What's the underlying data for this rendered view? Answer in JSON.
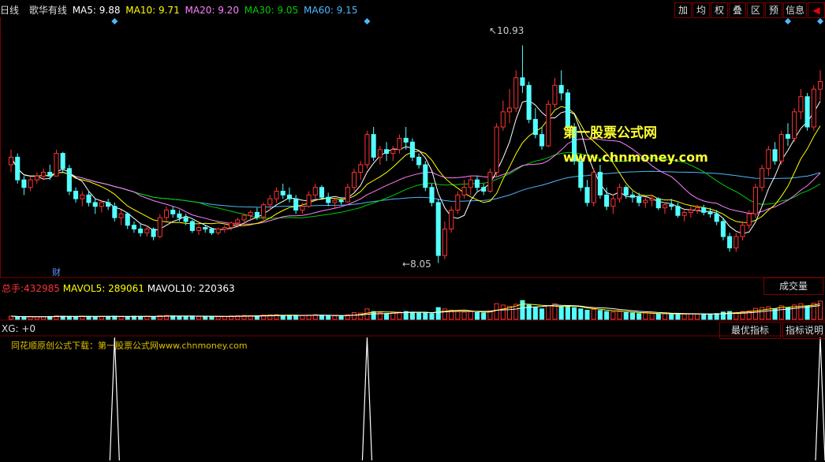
{
  "legend": {
    "period": "日线",
    "name": "歌华有线",
    "ma5": "MA5: 9.88",
    "ma10": "MA10: 9.71",
    "ma20": "MA20: 9.20",
    "ma30": "MA30: 9.05",
    "ma60": "MA60: 9.15"
  },
  "toolbar": [
    "加",
    "均",
    "权",
    "叠",
    "区",
    "预",
    "信息",
    "◀"
  ],
  "price_labels": {
    "high": "10.93",
    "low": "8.05"
  },
  "marker_cai": "财",
  "watermark": {
    "line1": "第一股票公式网",
    "line2": "www.chnmoney.com"
  },
  "volume": {
    "total_label": "总手:",
    "total_value": "432985",
    "mavol5": "MAVOL5: 289061",
    "mavol10": "MAVOL10: 220363",
    "tab": "成交量"
  },
  "xg": {
    "label": "XG: +0",
    "btn_best": "最优指标",
    "btn_desc": "指标说明",
    "note": "同花顺原创公式下载：第一股票公式网www.chnmoney.com"
  },
  "colors": {
    "up": "#ff3333",
    "down": "#54ffff",
    "ma5": "#ffffff",
    "ma10": "#ffff00",
    "ma20": "#ff80ff",
    "ma30": "#00cc00",
    "ma60": "#4db8ff",
    "border": "#7a0000"
  },
  "chart_data": {
    "type": "candlestick",
    "price_range": [
      7.9,
      11.3
    ],
    "candles": [
      [
        9.35,
        9.55,
        9.25,
        9.45
      ],
      [
        9.45,
        9.5,
        9.1,
        9.15
      ],
      [
        9.15,
        9.2,
        8.95,
        9.05
      ],
      [
        9.05,
        9.2,
        9.0,
        9.15
      ],
      [
        9.15,
        9.25,
        9.1,
        9.2
      ],
      [
        9.2,
        9.3,
        9.15,
        9.25
      ],
      [
        9.25,
        9.35,
        9.15,
        9.2
      ],
      [
        9.2,
        9.55,
        9.2,
        9.5
      ],
      [
        9.5,
        9.52,
        9.25,
        9.3
      ],
      [
        9.3,
        9.35,
        8.95,
        9.0
      ],
      [
        9.0,
        9.05,
        8.85,
        8.9
      ],
      [
        8.9,
        9.0,
        8.8,
        8.95
      ],
      [
        8.95,
        9.0,
        8.8,
        8.85
      ],
      [
        8.85,
        8.9,
        8.7,
        8.8
      ],
      [
        8.8,
        8.88,
        8.72,
        8.85
      ],
      [
        8.85,
        8.9,
        8.75,
        8.8
      ],
      [
        8.8,
        8.85,
        8.6,
        8.65
      ],
      [
        8.65,
        8.75,
        8.55,
        8.7
      ],
      [
        8.7,
        8.72,
        8.5,
        8.55
      ],
      [
        8.55,
        8.6,
        8.45,
        8.5
      ],
      [
        8.5,
        8.58,
        8.4,
        8.45
      ],
      [
        8.45,
        8.55,
        8.4,
        8.5
      ],
      [
        8.5,
        8.52,
        8.35,
        8.4
      ],
      [
        8.4,
        8.7,
        8.38,
        8.65
      ],
      [
        8.65,
        8.8,
        8.6,
        8.75
      ],
      [
        8.75,
        8.8,
        8.65,
        8.7
      ],
      [
        8.7,
        8.75,
        8.6,
        8.65
      ],
      [
        8.65,
        8.7,
        8.55,
        8.6
      ],
      [
        8.6,
        8.62,
        8.45,
        8.48
      ],
      [
        8.48,
        8.55,
        8.42,
        8.52
      ],
      [
        8.52,
        8.55,
        8.45,
        8.5
      ],
      [
        8.5,
        8.52,
        8.42,
        8.45
      ],
      [
        8.45,
        8.52,
        8.42,
        8.5
      ],
      [
        8.5,
        8.55,
        8.45,
        8.52
      ],
      [
        8.52,
        8.6,
        8.48,
        8.58
      ],
      [
        8.58,
        8.65,
        8.52,
        8.62
      ],
      [
        8.62,
        8.7,
        8.55,
        8.68
      ],
      [
        8.68,
        8.75,
        8.6,
        8.72
      ],
      [
        8.72,
        8.78,
        8.62,
        8.66
      ],
      [
        8.66,
        8.85,
        8.62,
        8.82
      ],
      [
        8.82,
        8.95,
        8.75,
        8.9
      ],
      [
        8.9,
        9.05,
        8.85,
        9.0
      ],
      [
        9.0,
        9.1,
        8.9,
        8.95
      ],
      [
        8.95,
        9.05,
        8.85,
        8.9
      ],
      [
        8.9,
        8.95,
        8.7,
        8.75
      ],
      [
        8.75,
        8.85,
        8.7,
        8.8
      ],
      [
        8.8,
        9.0,
        8.78,
        8.95
      ],
      [
        8.95,
        9.1,
        8.9,
        9.05
      ],
      [
        9.05,
        9.08,
        8.9,
        8.92
      ],
      [
        8.92,
        8.98,
        8.8,
        8.85
      ],
      [
        8.85,
        8.9,
        8.78,
        8.88
      ],
      [
        8.88,
        8.92,
        8.82,
        8.86
      ],
      [
        8.86,
        9.1,
        8.85,
        9.05
      ],
      [
        9.05,
        9.3,
        9.0,
        9.25
      ],
      [
        9.25,
        9.4,
        9.15,
        9.35
      ],
      [
        9.35,
        9.8,
        9.3,
        9.75
      ],
      [
        9.75,
        9.85,
        9.4,
        9.45
      ],
      [
        9.45,
        9.6,
        9.35,
        9.55
      ],
      [
        9.55,
        9.65,
        9.4,
        9.5
      ],
      [
        9.5,
        9.6,
        9.4,
        9.55
      ],
      [
        9.55,
        9.75,
        9.5,
        9.7
      ],
      [
        9.7,
        9.85,
        9.55,
        9.65
      ],
      [
        9.65,
        9.7,
        9.4,
        9.45
      ],
      [
        9.45,
        9.5,
        9.3,
        9.35
      ],
      [
        9.35,
        9.4,
        9.0,
        9.05
      ],
      [
        9.05,
        9.1,
        8.8,
        8.85
      ],
      [
        8.85,
        8.9,
        8.05,
        8.15
      ],
      [
        8.15,
        8.6,
        8.1,
        8.5
      ],
      [
        8.5,
        8.8,
        8.45,
        8.75
      ],
      [
        8.75,
        9.0,
        8.7,
        8.95
      ],
      [
        8.95,
        9.15,
        8.9,
        9.05
      ],
      [
        9.05,
        9.2,
        8.95,
        9.15
      ],
      [
        9.15,
        9.2,
        9.0,
        9.05
      ],
      [
        9.05,
        9.1,
        8.95,
        9.0
      ],
      [
        9.0,
        9.3,
        8.98,
        9.25
      ],
      [
        9.25,
        9.9,
        9.2,
        9.85
      ],
      [
        9.85,
        10.2,
        9.8,
        10.05
      ],
      [
        10.05,
        10.35,
        9.9,
        10.1
      ],
      [
        10.1,
        10.6,
        10.05,
        10.5
      ],
      [
        10.5,
        10.93,
        10.3,
        10.4
      ],
      [
        10.4,
        10.45,
        9.9,
        9.95
      ],
      [
        9.95,
        10.1,
        9.7,
        9.75
      ],
      [
        9.75,
        9.85,
        9.55,
        9.6
      ],
      [
        9.6,
        10.2,
        9.58,
        10.15
      ],
      [
        10.15,
        10.5,
        10.1,
        10.4
      ],
      [
        10.4,
        10.6,
        10.2,
        10.3
      ],
      [
        10.3,
        10.35,
        9.8,
        9.85
      ],
      [
        9.85,
        9.9,
        9.35,
        9.4
      ],
      [
        9.4,
        9.5,
        9.0,
        9.05
      ],
      [
        9.05,
        9.15,
        8.8,
        8.85
      ],
      [
        8.85,
        9.3,
        8.8,
        9.25
      ],
      [
        9.25,
        9.35,
        8.9,
        8.95
      ],
      [
        8.95,
        9.05,
        8.75,
        8.8
      ],
      [
        8.8,
        8.95,
        8.7,
        8.9
      ],
      [
        8.9,
        9.1,
        8.85,
        9.05
      ],
      [
        9.05,
        9.08,
        8.9,
        8.95
      ],
      [
        8.95,
        9.0,
        8.85,
        8.92
      ],
      [
        8.92,
        8.98,
        8.8,
        8.85
      ],
      [
        8.85,
        8.92,
        8.78,
        8.88
      ],
      [
        8.88,
        8.95,
        8.8,
        8.9
      ],
      [
        8.9,
        8.92,
        8.75,
        8.78
      ],
      [
        8.78,
        8.85,
        8.7,
        8.82
      ],
      [
        8.82,
        8.9,
        8.75,
        8.8
      ],
      [
        8.8,
        8.85,
        8.65,
        8.68
      ],
      [
        8.68,
        8.75,
        8.6,
        8.72
      ],
      [
        8.72,
        8.8,
        8.65,
        8.75
      ],
      [
        8.75,
        8.82,
        8.7,
        8.78
      ],
      [
        8.78,
        8.82,
        8.68,
        8.72
      ],
      [
        8.72,
        8.78,
        8.65,
        8.7
      ],
      [
        8.7,
        8.75,
        8.55,
        8.6
      ],
      [
        8.6,
        8.65,
        8.35,
        8.4
      ],
      [
        8.4,
        8.45,
        8.2,
        8.25
      ],
      [
        8.25,
        8.45,
        8.2,
        8.4
      ],
      [
        8.4,
        8.6,
        8.35,
        8.55
      ],
      [
        8.55,
        8.75,
        8.5,
        8.7
      ],
      [
        8.7,
        9.1,
        8.65,
        9.05
      ],
      [
        9.05,
        9.35,
        9.0,
        9.3
      ],
      [
        9.3,
        9.6,
        9.2,
        9.55
      ],
      [
        9.55,
        9.65,
        9.35,
        9.4
      ],
      [
        9.4,
        9.8,
        9.35,
        9.75
      ],
      [
        9.75,
        9.9,
        9.6,
        9.7
      ],
      [
        9.7,
        10.1,
        9.65,
        10.05
      ],
      [
        10.05,
        10.35,
        9.95,
        10.25
      ],
      [
        10.25,
        10.3,
        9.8,
        9.85
      ],
      [
        9.85,
        10.4,
        9.8,
        10.35
      ],
      [
        10.35,
        10.6,
        10.2,
        10.45
      ]
    ],
    "volumes": [
      0.12,
      0.1,
      0.09,
      0.1,
      0.09,
      0.1,
      0.11,
      0.14,
      0.12,
      0.11,
      0.1,
      0.12,
      0.11,
      0.1,
      0.11,
      0.1,
      0.12,
      0.11,
      0.1,
      0.12,
      0.11,
      0.12,
      0.1,
      0.14,
      0.15,
      0.13,
      0.12,
      0.11,
      0.12,
      0.11,
      0.1,
      0.11,
      0.1,
      0.11,
      0.13,
      0.14,
      0.15,
      0.14,
      0.12,
      0.16,
      0.17,
      0.18,
      0.15,
      0.14,
      0.15,
      0.14,
      0.16,
      0.18,
      0.15,
      0.13,
      0.13,
      0.12,
      0.17,
      0.26,
      0.24,
      0.4,
      0.3,
      0.25,
      0.22,
      0.24,
      0.28,
      0.3,
      0.26,
      0.24,
      0.25,
      0.22,
      0.45,
      0.4,
      0.35,
      0.3,
      0.28,
      0.3,
      0.26,
      0.24,
      0.32,
      0.6,
      0.55,
      0.5,
      0.58,
      0.72,
      0.55,
      0.45,
      0.4,
      0.52,
      0.6,
      0.5,
      0.48,
      0.45,
      0.4,
      0.35,
      0.38,
      0.34,
      0.3,
      0.28,
      0.3,
      0.26,
      0.24,
      0.22,
      0.24,
      0.22,
      0.2,
      0.21,
      0.2,
      0.22,
      0.2,
      0.21,
      0.2,
      0.19,
      0.2,
      0.22,
      0.28,
      0.3,
      0.26,
      0.3,
      0.32,
      0.42,
      0.45,
      0.48,
      0.4,
      0.52,
      0.45,
      0.55,
      0.6,
      0.5,
      0.62,
      0.7
    ],
    "signals_index": [
      16,
      55,
      125
    ]
  }
}
